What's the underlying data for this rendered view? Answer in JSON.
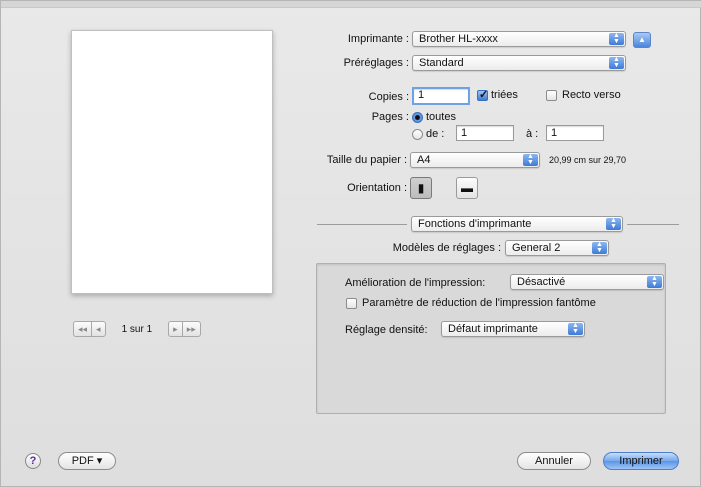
{
  "preview": {
    "page_label": "1 sur 1",
    "first_label": "◂◂",
    "prev_label": "◂",
    "next_label": "▸",
    "last_label": "▸▸"
  },
  "printer": {
    "label": "Imprimante :",
    "value": "Brother HL-xxxx"
  },
  "presets": {
    "label": "Préréglages :",
    "value": "Standard"
  },
  "copies": {
    "label": "Copies :",
    "value": "1",
    "collated_label": "triées",
    "collated_checked": true,
    "duplex_label": "Recto verso",
    "duplex_checked": false
  },
  "pages": {
    "label": "Pages :",
    "all_label": "toutes",
    "from_label": "de :",
    "from_value": "1",
    "to_label": "à :",
    "to_value": "1",
    "selected": "all"
  },
  "paper": {
    "label": "Taille du papier :",
    "value": "A4",
    "dimensions": "20,99 cm sur 29,70"
  },
  "orientation": {
    "label": "Orientation :",
    "selected": "portrait"
  },
  "section_popup": {
    "value": "Fonctions d'imprimante"
  },
  "feature_sets": {
    "label": "Modèles de réglages :",
    "value": "General 2"
  },
  "options": {
    "improve_label": "Amélioration de l'impression:",
    "improve_value": "Désactivé",
    "ghost_label": "Paramètre de réduction de l'impression fantôme",
    "ghost_checked": false,
    "density_label": "Réglage densité:",
    "density_value": "Défaut imprimante"
  },
  "footer": {
    "help": "?",
    "pdf_label": "PDF ▾",
    "cancel_label": "Annuler",
    "print_label": "Imprimer"
  },
  "colors": {
    "accent": "#3d7ad8",
    "background": "#e3e3e3",
    "group": "#d9d9d9"
  }
}
